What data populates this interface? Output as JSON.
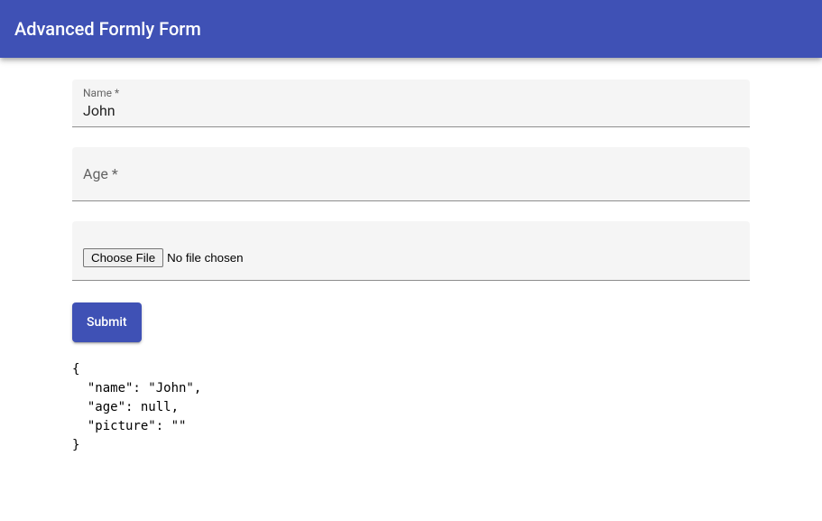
{
  "header": {
    "title": "Advanced Formly Form"
  },
  "form": {
    "name_label": "Name *",
    "name_value": "John",
    "age_label": "Age *",
    "age_value": "",
    "file_button": "Choose File",
    "file_status": "No file chosen",
    "submit_label": "Submit"
  },
  "model_output": "{\n  \"name\": \"John\",\n  \"age\": null,\n  \"picture\": \"\"\n}"
}
